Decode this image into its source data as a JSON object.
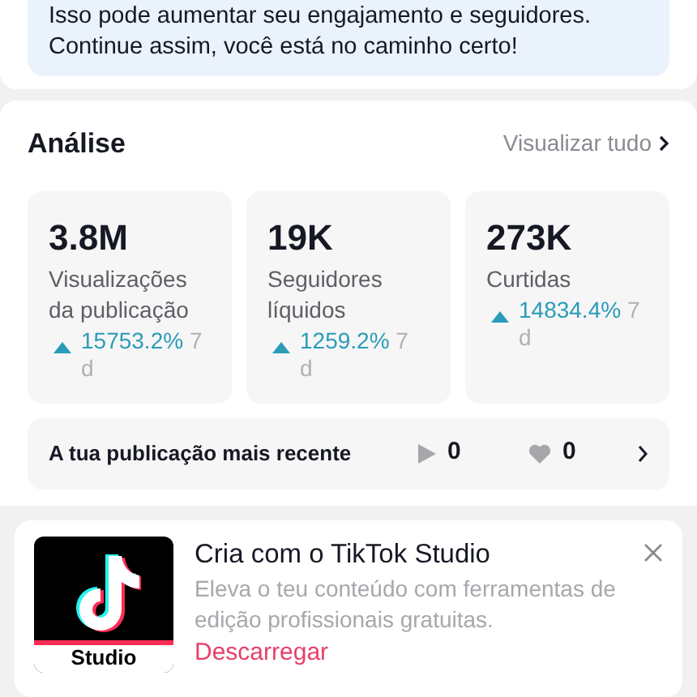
{
  "tip": {
    "lines": [
      "Isso pode aumentar seu engajamento e seguidores.",
      "Continue assim, você está no caminho certo!"
    ]
  },
  "analysis": {
    "title": "Análise",
    "view_all": "Visualizar tudo",
    "stats": [
      {
        "value": "3.8M",
        "label": "Visualizações da publicação",
        "change": "15753.2%",
        "period": "7 d"
      },
      {
        "value": "19K",
        "label": "Seguidores líquidos",
        "change": "1259.2%",
        "period": "7 d"
      },
      {
        "value": "273K",
        "label": "Curtidas",
        "change": "14834.4%",
        "period": "7 d"
      }
    ],
    "recent_post": {
      "label": "A tua publicação mais recente",
      "views": "0",
      "likes": "0"
    }
  },
  "promo": {
    "logo_text": "Studio",
    "title": "Cria com o TikTok Studio",
    "description": "Eleva o teu conteúdo com ferramentas de edição profissionais gratuitas.",
    "action": "Descarregar"
  }
}
